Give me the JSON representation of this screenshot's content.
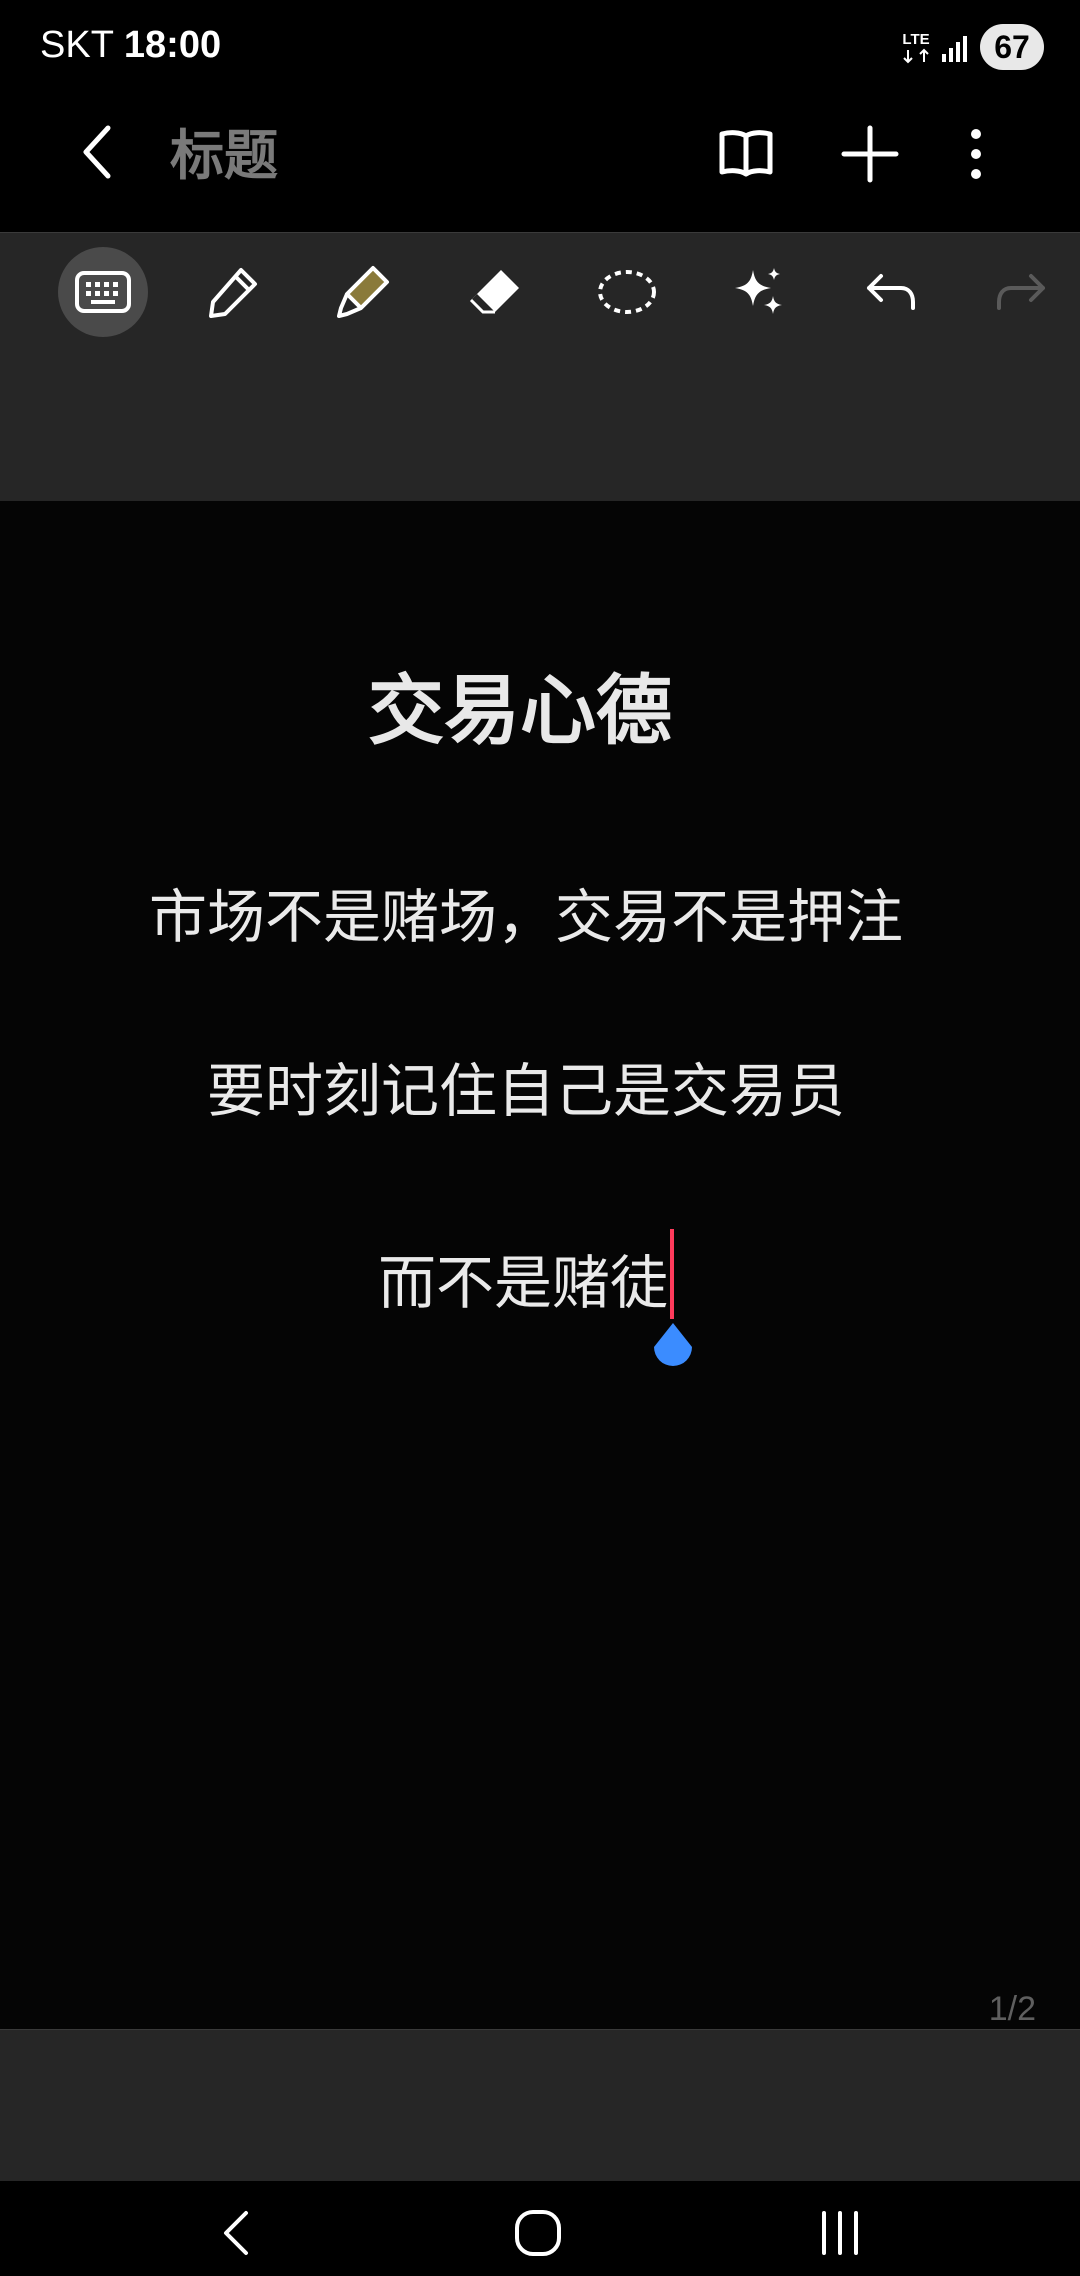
{
  "status_bar": {
    "carrier": "SKT",
    "time": "18:00",
    "network": "LTE",
    "battery": "67"
  },
  "app_bar": {
    "title": "标题"
  },
  "toolbar": {
    "tools": [
      "keyboard",
      "pen",
      "highlighter",
      "eraser",
      "lasso",
      "ai-assist",
      "undo",
      "redo"
    ],
    "active_tool": "keyboard"
  },
  "note": {
    "heading": "交易心德",
    "lines": [
      "市场不是赌场，交易不是押注",
      "要时刻记住自己是交易员",
      "而不是赌徒"
    ],
    "page_indicator": "1/2"
  },
  "colors": {
    "background": "#000000",
    "toolbar": "#262626",
    "caret": "#ff3b5c",
    "cursor_handle": "#3b8cff",
    "highlighter": "#8a7a3a"
  }
}
